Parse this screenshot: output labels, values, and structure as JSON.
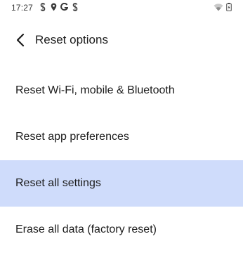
{
  "status_bar": {
    "time": "17:27",
    "left_icons": [
      "sync-s-icon",
      "location-icon",
      "google-icon",
      "sync-s-icon"
    ],
    "right_icons": [
      "wifi-icon",
      "battery-icon"
    ]
  },
  "app_bar": {
    "title": "Reset options",
    "back_icon": "arrow-back-icon"
  },
  "options": [
    {
      "label": "Reset Wi-Fi, mobile & Bluetooth",
      "selected": false
    },
    {
      "label": "Reset app preferences",
      "selected": false
    },
    {
      "label": "Reset all settings",
      "selected": true
    },
    {
      "label": "Erase all data (factory reset)",
      "selected": false
    }
  ],
  "colors": {
    "selected_background": "#cfdcfb",
    "text": "#1c1c1c",
    "background": "#ffffff"
  }
}
